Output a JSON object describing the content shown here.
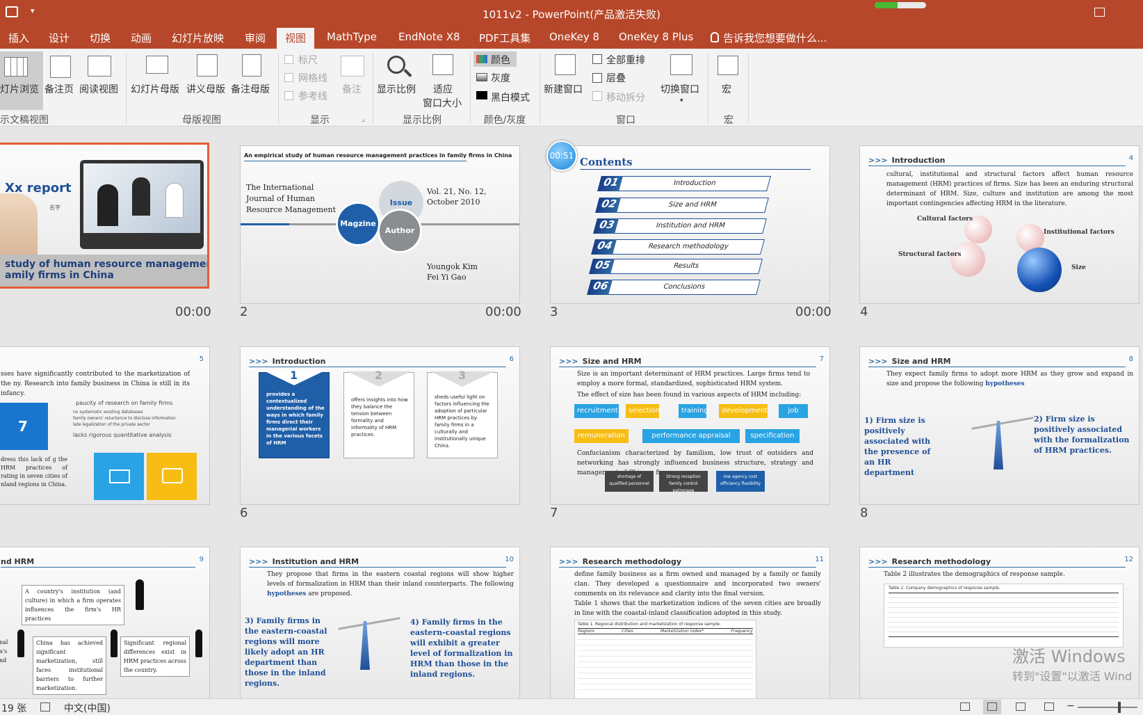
{
  "window": {
    "title": "1011v2 - PowerPoint(产品激活失败)"
  },
  "tabs": [
    "插入",
    "设计",
    "切换",
    "动画",
    "幻灯片放映",
    "审阅",
    "视图",
    "MathType",
    "EndNote X8",
    "PDF工具集",
    "OneKey 8",
    "OneKey 8 Plus",
    "告诉我您想要做什么..."
  ],
  "ribbon": {
    "slide_browse": "灯片浏览",
    "notes_page": "备注页",
    "reading_view": "阅读视图",
    "group_views": "示文稿视图",
    "slide_master": "幻灯片母版",
    "handout_master": "讲义母版",
    "notes_master": "备注母版",
    "group_master": "母版视图",
    "ruler": "标尺",
    "gridlines": "网格线",
    "guides": "参考线",
    "notes": "备注",
    "group_show": "显示",
    "zoom": "显示比例",
    "fit_l1": "适应",
    "fit_l2": "窗口大小",
    "group_zoom": "显示比例",
    "color": "颜色",
    "gray": "灰度",
    "bw": "黑白模式",
    "group_color": "颜色/灰度",
    "new_window": "新建窗口",
    "arrange_all": "全部重排",
    "cascade": "层叠",
    "move_split": "移动拆分",
    "switch_window": "切换窗口",
    "group_window": "窗口",
    "macro": "宏",
    "group_macro": "宏"
  },
  "slides": {
    "s1": {
      "title": "Xx  report",
      "name": "名字",
      "caption_l1": "study of human resource management",
      "caption_l2": "amily firms in China",
      "time": "00:00"
    },
    "s2": {
      "num": "2",
      "time": "00:00",
      "header": "An empirical study of human resource management practices in family firms in China",
      "journal_l1": "The International",
      "journal_l2": "Journal of Human",
      "journal_l3": "Resource Management",
      "issue": "Issue",
      "magzine": "Magzine",
      "author": "Author",
      "vol_l1": "Vol. 21, No. 12,",
      "vol_l2": "October 2010",
      "auth_l1": "Youngok Kim",
      "auth_l2": "Fei Yi Gao"
    },
    "s3": {
      "num": "3",
      "time": "00:00",
      "timer": "00:51",
      "title": "Contents",
      "items": [
        {
          "n": "01",
          "t": "Introduction"
        },
        {
          "n": "02",
          "t": "Size and HRM"
        },
        {
          "n": "03",
          "t": "Institution and HRM"
        },
        {
          "n": "04",
          "t": "Research methodology"
        },
        {
          "n": "05",
          "t": "Results"
        },
        {
          "n": "06",
          "t": "Conclusions"
        }
      ]
    },
    "s4": {
      "num": "4",
      "header": "Introduction",
      "pn": "4",
      "body": "cultural, institutional and structural factors affect human resource management (HRM) practices of firms. Size has been an enduring structural determinant of HRM. Size, culture and institution are among the most important contingencies affecting HRM in the literature.",
      "cultural": "Cultural factors",
      "institutional": "Institutional factors",
      "structural": "Structural factors",
      "size": "Size"
    },
    "s5": {
      "pn": "5",
      "body": "sses have significantly contributed to the marketization of the ny. Research into family business in China is still in its infancy.",
      "big": "7",
      "p1": "paucity of research on family firms",
      "p2": "no systematic existing databases",
      "p3": "family owners' reluctance to disclose information",
      "p4": "late legalization of the private sector",
      "p5": "lacks rigorous quantitative analysis",
      "bottom": "dress this lack of g the HRM practices of rating in seven cities of nland regions in China."
    },
    "s6": {
      "num": "6",
      "header": "Introduction",
      "pn": "6",
      "b1": "provides a contextualized understanding of the ways in which family firms direct their managerial workers in the various facets of HRM",
      "b2": "offers insights into how they balance the tension between formality and informality of HRM practices.",
      "b3": "sheds useful light on factors influencing the adoption of particular HRM practices by family firms in a culturally and institutionally unique China."
    },
    "s7": {
      "num": "7",
      "header": "Size and HRM",
      "pn": "7",
      "body": "Size is an important determinant of HRM practices. Large firms tend to employ a more formal, standardized, sophisticated HRM system.",
      "effect": "The effect of size has been found in various aspects of HRM including:",
      "tags": [
        "recruitment",
        "selection",
        "training",
        "development",
        "job",
        "remuneration",
        "performance appraisal (PA)",
        "specification"
      ],
      "conf": "Confucianism characterized by familism, low trust of outsiders and networking has strongly influenced business structure, strategy and management of Chinese firms",
      "g1": "shortage of qualified personnel",
      "g2": "Strong reception family control patronage",
      "g3": "low agency cost efficiency flexibility"
    },
    "s8": {
      "num": "8",
      "header": "Size and HRM",
      "pn": "8",
      "body": "They expect family firms to adopt more HRM as they grow and expand in size and propose the following",
      "hyp": "hypotheses",
      "h1": "1) Firm size is positively associated with the presence of an HR department",
      "h2": "2) Firm size is positively associated with the formalization of HRM practices."
    },
    "s9": {
      "header": "nd HRM",
      "pn": "9",
      "box1": "A country's institution (and culture) in which a firm operates influences the firm's HR practices",
      "box2": "China has achieved significant marketization, still faces institutional barriers to further marketization.",
      "box3": "Significant regional differences exist in HRM practices across the country.",
      "left": "nal a's nd"
    },
    "s10": {
      "header": "Institution and HRM",
      "pn": "10",
      "body": "They propose that firms in the eastern coastal regions will show higher levels of formalization in HRM than their inland counterparts. The following",
      "hyp": "hypotheses",
      "tail": "are proposed.",
      "h3": "3) Family firms in the eastern-coastal regions will more likely adopt an HR department than those in the inland regions.",
      "h4": "4) Family firms in the eastern-coastal regions will exhibit a greater level of formalization in HRM than those in the inland regions."
    },
    "s11": {
      "header": "Research methodology",
      "pn": "11",
      "body": "define family business as a firm owned and managed by a family or family clan. They developed a questionnaire and incorporated two owners' comments on its relevance and clarity into the final version.",
      "body2": "Table 1 shows that the marketization indices of the seven cities are broadly in line with the coastal-inland classification adopted in this study.",
      "table_title": "Table 1.  Regional distribution and marketization of response sample.",
      "cols": [
        "Regions",
        "Cities",
        "Marketization index*",
        "Frequency"
      ]
    },
    "s12": {
      "header": "Research methodology",
      "pn": "12",
      "body": "Table 2 illustrates the demographics of response sample.",
      "table_title": "Table 2.  Company demographics of response sample."
    }
  },
  "watermark": {
    "l1": "激活 Windows",
    "l2": "转到\"设置\"以激活 Wind"
  },
  "status": {
    "slides": "19 张",
    "lang": "中文(中国)"
  }
}
